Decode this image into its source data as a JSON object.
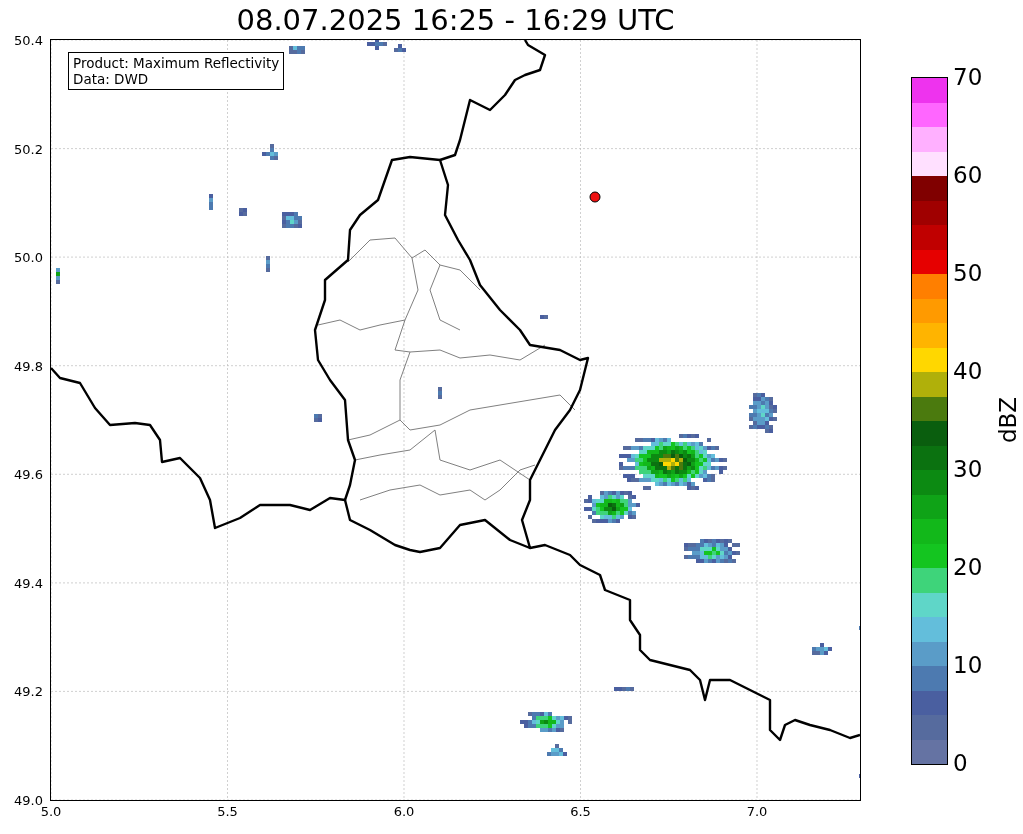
{
  "title": "08.07.2025 16:25 - 16:29 UTC",
  "info_box": [
    "Product: Maximum Reflectivity",
    "Data: DWD"
  ],
  "x_ticks": [
    "5.0",
    "5.5",
    "6.0",
    "6.5",
    "7.0"
  ],
  "y_ticks": [
    "50.4",
    "50.2",
    "50.0",
    "49.8",
    "49.6",
    "49.4",
    "49.2",
    "49.0"
  ],
  "colorbar": {
    "label": "dBZ",
    "ticks": [
      "70",
      "60",
      "50",
      "40",
      "30",
      "20",
      "10",
      "0"
    ],
    "bins": [
      {
        "color": "#ee33ee"
      },
      {
        "color": "#ff66ff"
      },
      {
        "color": "#ffb0ff"
      },
      {
        "color": "#ffe0ff"
      },
      {
        "color": "#800000"
      },
      {
        "color": "#a00000"
      },
      {
        "color": "#c00000"
      },
      {
        "color": "#e60000"
      },
      {
        "color": "#ff7f00"
      },
      {
        "color": "#ff9a00"
      },
      {
        "color": "#ffb400"
      },
      {
        "color": "#ffd700"
      },
      {
        "color": "#b0b00a"
      },
      {
        "color": "#4b7a0e"
      },
      {
        "color": "#0a5e0e"
      },
      {
        "color": "#0b7210"
      },
      {
        "color": "#0c8a12"
      },
      {
        "color": "#0fa317"
      },
      {
        "color": "#12b81a"
      },
      {
        "color": "#14c520"
      },
      {
        "color": "#3ed47a"
      },
      {
        "color": "#5fd6c8"
      },
      {
        "color": "#63bedb"
      },
      {
        "color": "#5a9cc8"
      },
      {
        "color": "#4d7ab0"
      },
      {
        "color": "#4a5fa0"
      },
      {
        "color": "#566b9e"
      },
      {
        "color": "#6573a3"
      }
    ]
  }
}
